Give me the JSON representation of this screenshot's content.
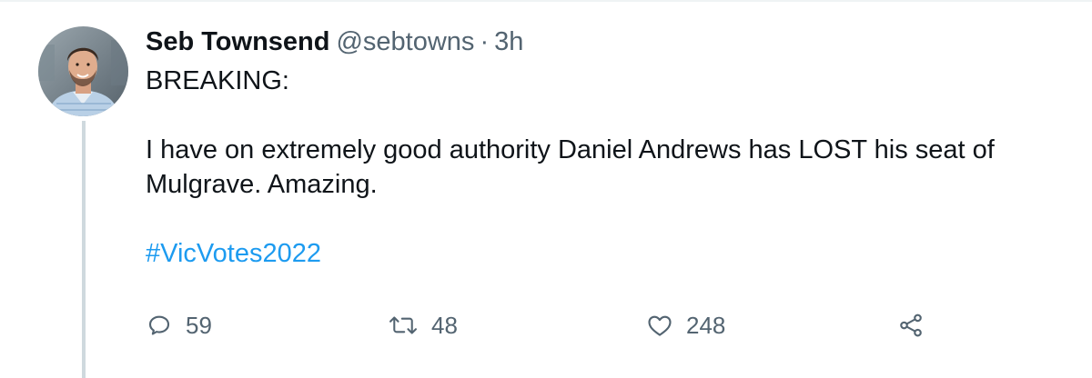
{
  "tweet": {
    "author_name": "Seb Townsend",
    "handle": "@sebtowns",
    "separator": "·",
    "time": "3h",
    "text_lines": [
      "BREAKING:",
      "I have on extremely good authority Daniel Andrews has LOST his seat of",
      "Mulgrave. Amazing."
    ],
    "hashtag": "#VicVotes2022"
  },
  "actions": {
    "reply_count": "59",
    "retweet_count": "48",
    "like_count": "248"
  },
  "icons": {
    "reply": "reply-icon",
    "retweet": "retweet-icon",
    "like": "heart-icon",
    "share": "share-icon"
  },
  "colors": {
    "text": "#0f1419",
    "secondary": "#536471",
    "link": "#1d9bf0",
    "thread_line": "#cfd9de"
  }
}
